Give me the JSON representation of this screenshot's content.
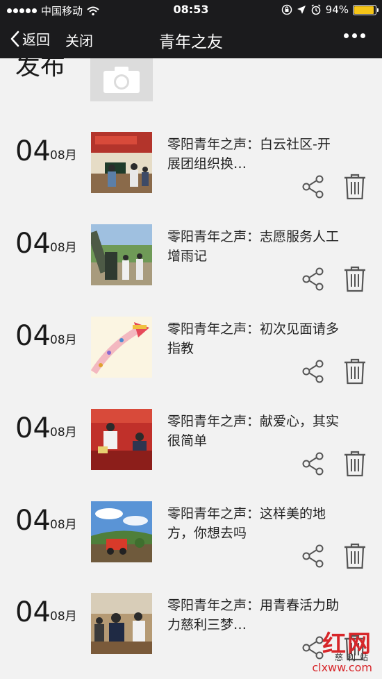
{
  "status_bar": {
    "carrier": "中国移动",
    "time": "08:53",
    "battery_text": "94%",
    "battery_level": 0.94
  },
  "nav": {
    "back_label": "返回",
    "close_label": "关闭",
    "title": "青年之友"
  },
  "top_fragment": "发布",
  "items": [
    {
      "day": "04",
      "month": "08月",
      "title": "零阳青年之声：白云社区-开展团组织换…"
    },
    {
      "day": "04",
      "month": "08月",
      "title": "零阳青年之声：志愿服务人工增雨记"
    },
    {
      "day": "04",
      "month": "08月",
      "title": "零阳青年之声：初次见面请多指教"
    },
    {
      "day": "04",
      "month": "08月",
      "title": "零阳青年之声：献爱心，其实很简单"
    },
    {
      "day": "04",
      "month": "08月",
      "title": "零阳青年之声：这样美的地方，你想去吗"
    },
    {
      "day": "04",
      "month": "08月",
      "title": "零阳青年之声：用青春活力助力慈利三梦…"
    }
  ],
  "watermark": {
    "brand": "红网",
    "sub": "慈利站",
    "url": "clxww.com"
  },
  "colors": {
    "bar_background": "#1b1b1d",
    "page_background": "#f2f2f2",
    "battery": "#f5c518",
    "watermark_red": "#d7262a"
  }
}
